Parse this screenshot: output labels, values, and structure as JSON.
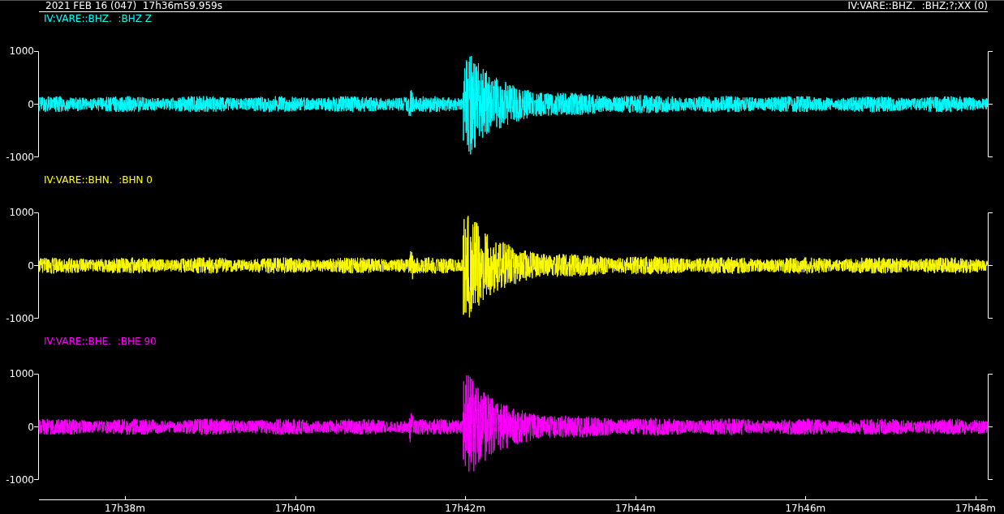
{
  "header": {
    "start_time": "2021 FEB 16 (047)  17h36m59.959s",
    "channel_info": "IV:VARE::BHZ.  :BHZ;?;XX (0)"
  },
  "traces": [
    {
      "label": "IV:VARE::BHZ.  :BHZ Z",
      "color": "#00ffff",
      "y_labels": [
        "1000",
        "0",
        "-1000"
      ]
    },
    {
      "label": "IV:VARE::BHN.  :BHN 0",
      "color": "#ffff00",
      "y_labels": [
        "1000",
        "0",
        "-1000"
      ]
    },
    {
      "label": "IV:VARE::BHE.  :BHE 90",
      "color": "#ff00ff",
      "y_labels": [
        "1000",
        "0",
        "-1000"
      ]
    }
  ],
  "time_axis": {
    "labels": [
      "17h38m",
      "17h40m",
      "17h42m",
      "17h44m",
      "17h46m",
      "17h48m"
    ]
  }
}
